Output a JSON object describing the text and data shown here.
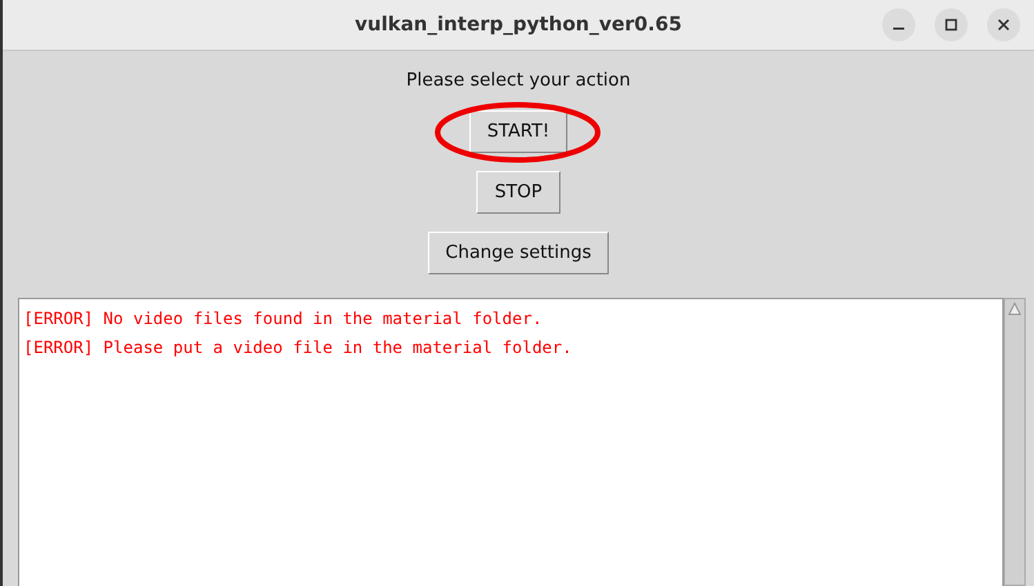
{
  "window": {
    "title": "vulkan_interp_python_ver0.65"
  },
  "prompt": "Please select your action",
  "buttons": [
    {
      "label": "START!",
      "circled": true
    },
    {
      "label": "STOP",
      "circled": false
    },
    {
      "label": "Change settings",
      "circled": false
    }
  ],
  "log": [
    {
      "kind": "error",
      "text": "[ERROR] No video files found in the material folder."
    },
    {
      "kind": "error",
      "text": "[ERROR] Please put a video file in the material folder."
    }
  ]
}
